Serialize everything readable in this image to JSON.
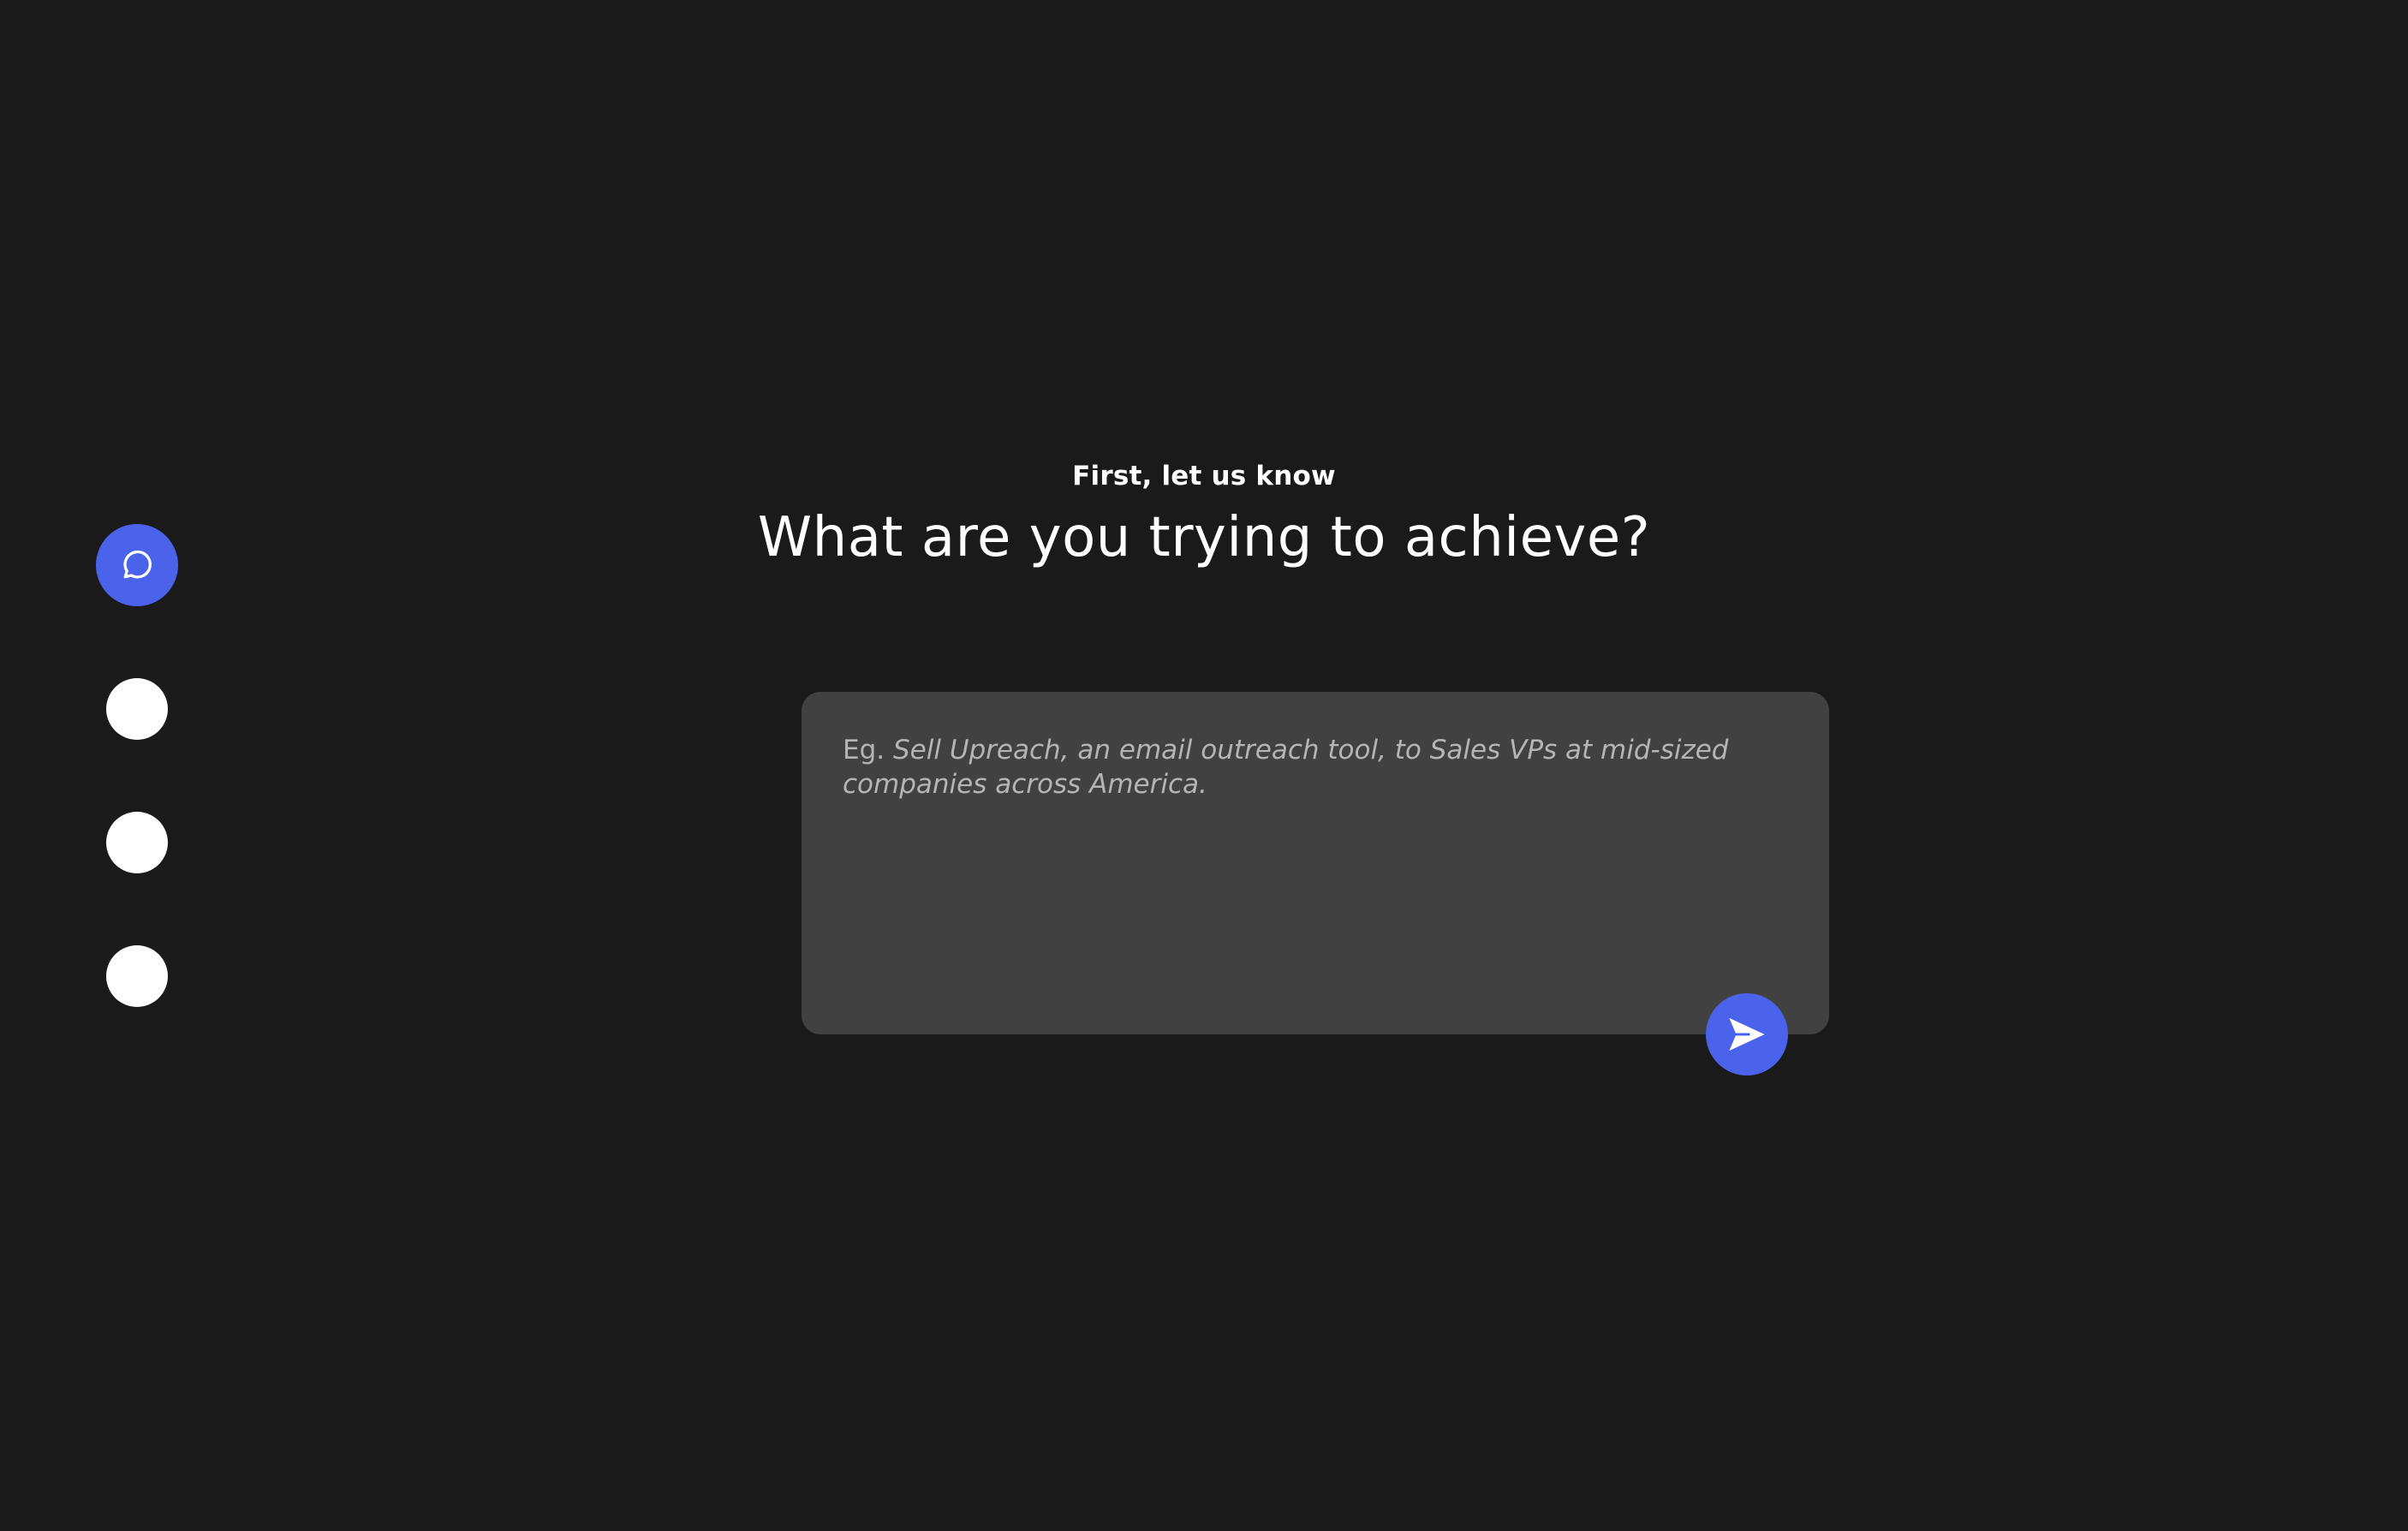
{
  "header": {
    "eyebrow": "First, let us know",
    "title": "What are you trying to achieve?"
  },
  "composer": {
    "placeholder_prefix": "Eg.",
    "placeholder_example": "Sell Upreach, an email outreach tool, to Sales VPs at mid-sized companies across America.",
    "value": ""
  },
  "steps": {
    "active_icon": "chat-bubble-icon",
    "count": 4,
    "active_index": 0
  },
  "send_button": {
    "icon": "send-icon"
  },
  "colors": {
    "background": "#1a1a1a",
    "card": "#414141",
    "accent": "#4a63ea",
    "text": "#ffffff",
    "placeholder": "#b5b5b5"
  }
}
